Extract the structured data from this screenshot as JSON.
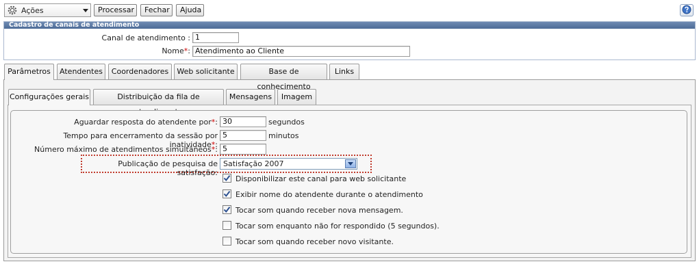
{
  "toolbar": {
    "actions_label": "Ações",
    "buttons": [
      "Processar",
      "Fechar",
      "Ajuda"
    ]
  },
  "panel": {
    "title": "Cadastro de canais de atendimento",
    "fields": [
      {
        "label": "Canal de atendimento :",
        "value": "1",
        "required": false
      },
      {
        "label": "Nome",
        "suffix": ":",
        "value": "Atendimento ao Cliente",
        "required": true
      }
    ]
  },
  "tabs": [
    "Parâmetros",
    "Atendentes",
    "Coordenadores",
    "Web solicitante",
    "Base de conhecimento",
    "Links"
  ],
  "subtabs": [
    "Configurações gerais",
    "Distribuição da fila de atendimento",
    "Mensagens",
    "Imagem"
  ],
  "settings": {
    "rows": [
      {
        "label": "Aguardar resposta do atendente por",
        "value": "30",
        "unit": "segundos"
      },
      {
        "label": "Tempo para encerramento da sessão por inatividade",
        "value": "5",
        "unit": "minutos"
      },
      {
        "label": "Número máximo de atendimentos simultâneos",
        "value": "5",
        "unit": ""
      }
    ],
    "required_mark": "*",
    "colon": ":",
    "survey_label": "Publicação de pesquisa de satisfação:",
    "survey_value": "Satisfação 2007",
    "checkboxes": [
      {
        "label": "Disponibilizar este canal para web solicitante",
        "checked": true
      },
      {
        "label": "Exibir nome do atendente durante o atendimento",
        "checked": true
      },
      {
        "label": "Tocar som quando receber nova mensagem.",
        "checked": true
      },
      {
        "label": "Tocar som enquanto não for respondido (5 segundos).",
        "checked": false
      },
      {
        "label": "Tocar som quando receber novo visitante.",
        "checked": false
      }
    ]
  },
  "colors": {
    "header_bar": "#5a77a3",
    "required": "#cc0000",
    "highlight_border": "#c0392b"
  }
}
